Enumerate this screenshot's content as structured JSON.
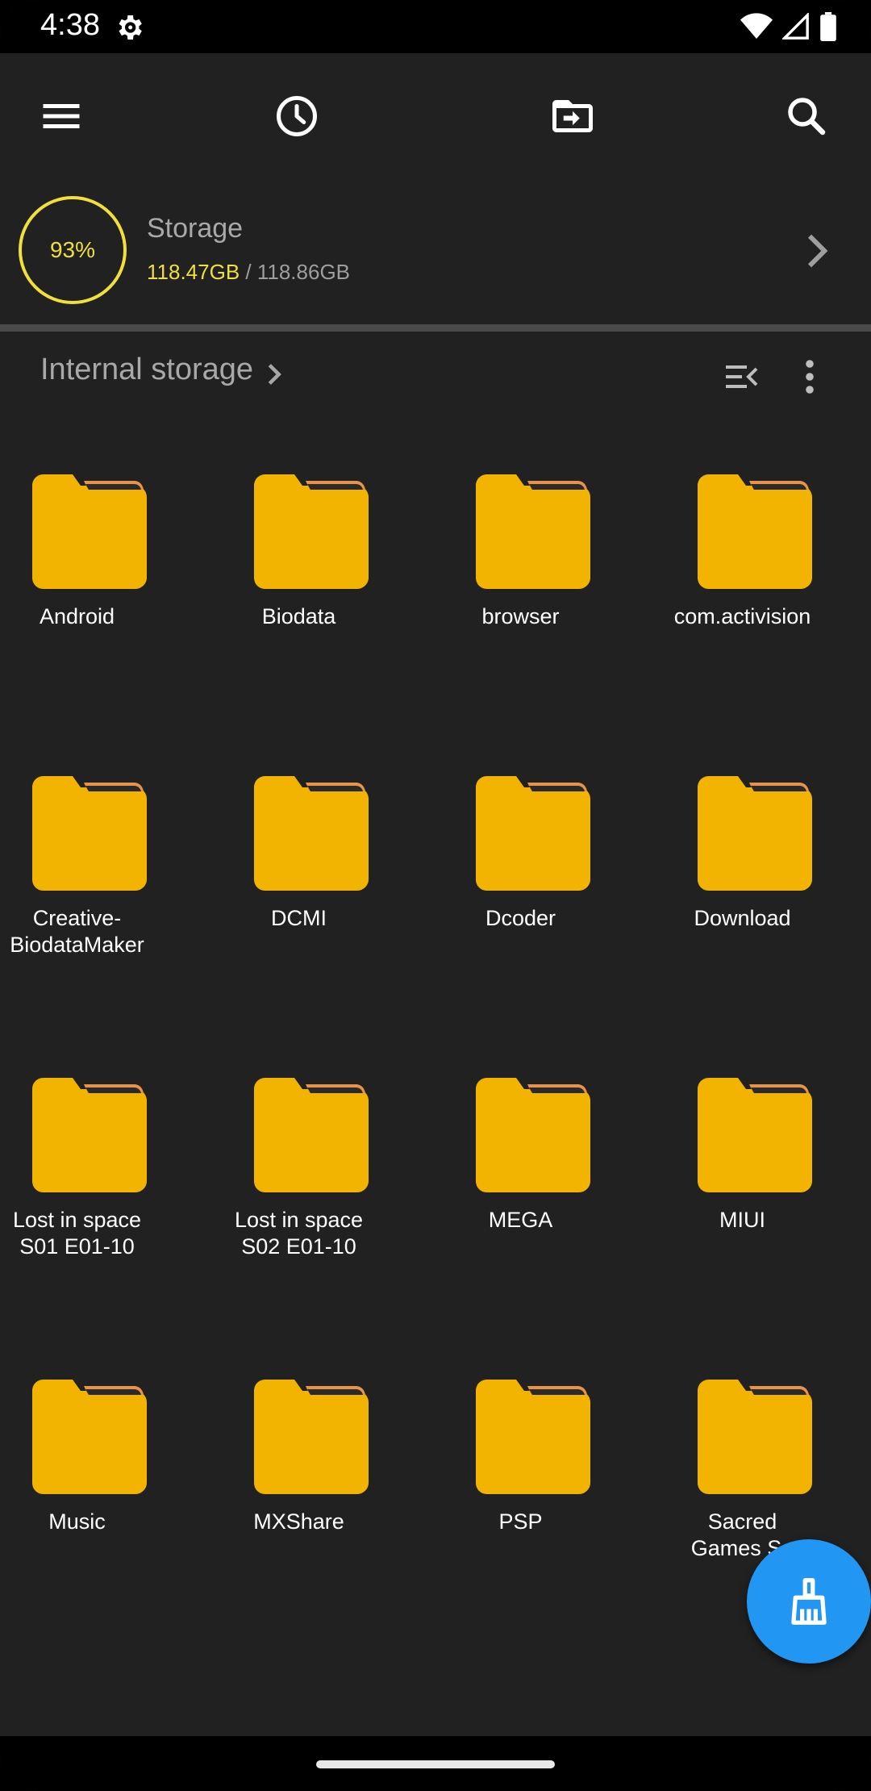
{
  "status_bar": {
    "time": "4:38",
    "icons": [
      "gear-icon",
      "wifi-icon",
      "signal-icon",
      "battery-icon"
    ]
  },
  "app_bar": {
    "icons": [
      "menu-icon",
      "history-icon",
      "move-to-folder-icon",
      "search-icon"
    ]
  },
  "storage": {
    "percent_label": "93%",
    "percent_value": 93,
    "title": "Storage",
    "used": "118.47GB",
    "separator": " / ",
    "total": "118.86GB"
  },
  "path": {
    "label": "Internal storage",
    "icons": [
      "chevron-right-icon",
      "sort-icon",
      "more-vert-icon"
    ]
  },
  "folders": [
    {
      "name": "Android"
    },
    {
      "name": "Biodata"
    },
    {
      "name": "browser"
    },
    {
      "name": "com.activision"
    },
    {
      "name": "Creative-\nBiodataMaker"
    },
    {
      "name": "DCMI"
    },
    {
      "name": "Dcoder"
    },
    {
      "name": "Download"
    },
    {
      "name": "Lost in space\nS01 E01-10"
    },
    {
      "name": "Lost in space\nS02 E01-10"
    },
    {
      "name": "MEGA"
    },
    {
      "name": "MIUI"
    },
    {
      "name": "Music"
    },
    {
      "name": "MXShare"
    },
    {
      "name": "PSP"
    },
    {
      "name": "Sacred\nGames Se"
    }
  ],
  "fab": {
    "icon": "broom-icon"
  },
  "colors": {
    "background": "#212121",
    "folder": "#f2b400",
    "folder_tab": "#e9934a",
    "accent_yellow": "#f1df3b",
    "fab": "#2196f3"
  }
}
